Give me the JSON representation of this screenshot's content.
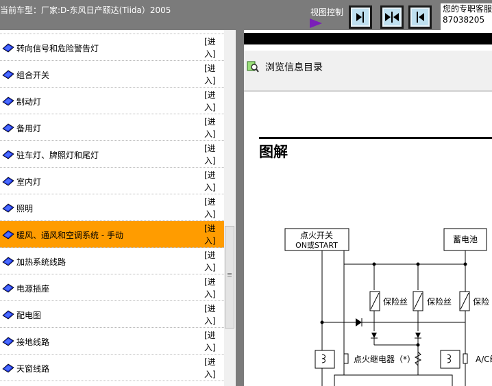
{
  "header": {
    "model_text": "当前车型：厂家:D-东风日产颐达(Tiida）2005",
    "view_control_label": "视图控制",
    "contact_line1": "您的专职客服",
    "contact_line2": "87038205"
  },
  "nav": {
    "enter_line1": "[进",
    "enter_line2": "入]",
    "items": [
      {
        "label": "转向信号和危险警告灯"
      },
      {
        "label": "组合开关"
      },
      {
        "label": "制动灯"
      },
      {
        "label": "备用灯"
      },
      {
        "label": "驻车灯、牌照灯和尾灯"
      },
      {
        "label": "室内灯"
      },
      {
        "label": "照明"
      },
      {
        "label": "暖风、通风和空调系统 - 手动"
      },
      {
        "label": "加热系统线路"
      },
      {
        "label": "电源插座"
      },
      {
        "label": "配电图"
      },
      {
        "label": "接地线路"
      },
      {
        "label": "天窗线路"
      }
    ],
    "selected_index": 7,
    "selected_color": "#ff9c00"
  },
  "content": {
    "browse_label": "浏览信息目录",
    "doc_title": "图解",
    "diagram": {
      "ignition_switch_line1": "点火开关",
      "ignition_switch_line2": "ON或START",
      "battery": "蓄电池",
      "fuse": "保险丝",
      "fuse_partial": "保险",
      "ignition_relay": "点火继电器（*）",
      "ac_relay_partial": "A/C继"
    }
  }
}
